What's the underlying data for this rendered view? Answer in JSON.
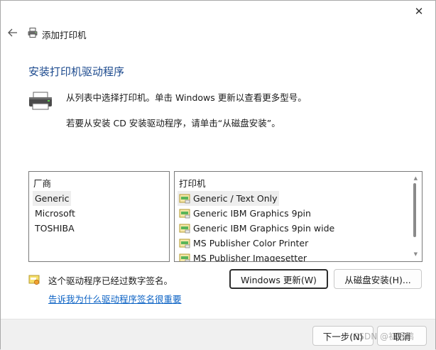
{
  "window": {
    "close_glyph": "✕",
    "title": "添加打印机"
  },
  "content": {
    "heading": "安装打印机驱动程序",
    "description_line1": "从列表中选择打印机。单击 Windows 更新以查看更多型号。",
    "description_line2": "若要从安装 CD 安装驱动程序，请单击“从磁盘安装”。"
  },
  "manufacturers": {
    "header": "厂商",
    "items": [
      {
        "label": "Generic",
        "selected": true
      },
      {
        "label": "Microsoft",
        "selected": false
      },
      {
        "label": "TOSHIBA",
        "selected": false
      }
    ]
  },
  "printers": {
    "header": "打印机",
    "items": [
      {
        "label": "Generic / Text Only",
        "selected": true
      },
      {
        "label": "Generic IBM Graphics 9pin",
        "selected": false
      },
      {
        "label": "Generic IBM Graphics 9pin wide",
        "selected": false
      },
      {
        "label": "MS Publisher Color Printer",
        "selected": false
      },
      {
        "label": "MS Publisher Imagesetter",
        "selected": false
      }
    ]
  },
  "signature": {
    "status_text": "这个驱动程序已经过数字签名。",
    "link_text": "告诉我为什么驱动程序签名很重要"
  },
  "buttons": {
    "windows_update": "Windows 更新(W)",
    "from_disk": "从磁盘安装(H)...",
    "next": "下一步(N)",
    "cancel": "取消"
  },
  "watermark": "CSDN @初眠鹏",
  "colors": {
    "heading": "#1c4a8e",
    "link": "#0b62c4",
    "selection": "#eeeeee"
  },
  "icons": {
    "back": "back-arrow-icon",
    "title_printer": "printer-icon",
    "large_printer": "printer-icon",
    "driver_item": "printer-driver-icon",
    "signed": "signed-driver-icon"
  }
}
